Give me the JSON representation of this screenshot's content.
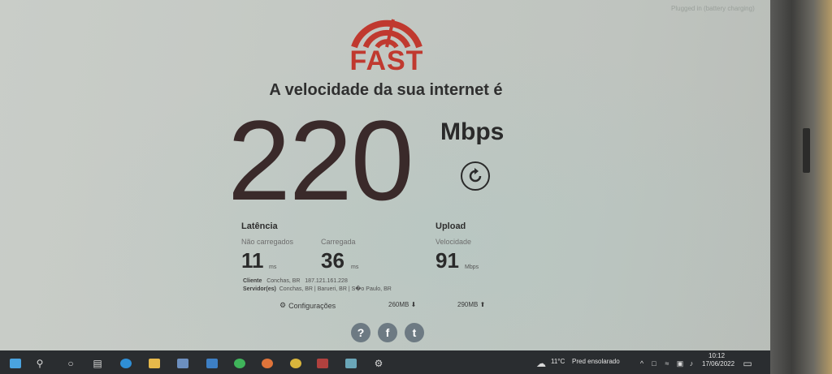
{
  "top_right_tag": "Plugged in (battery charging)",
  "logo": {
    "text": "FAST"
  },
  "headline": "A velocidade da sua internet é",
  "speed": {
    "value": "220",
    "unit": "Mbps"
  },
  "latency": {
    "title": "Latência",
    "unloaded_label": "Não carregados",
    "unloaded_value": "11",
    "unloaded_unit": "ms",
    "loaded_label": "Carregada",
    "loaded_value": "36",
    "loaded_unit": "ms"
  },
  "upload": {
    "title": "Upload",
    "label": "Velocidade",
    "value": "91",
    "unit": "Mbps"
  },
  "client": {
    "label": "Cliente",
    "location": "Conchas, BR",
    "ip": "187.121.161.228"
  },
  "servers": {
    "label": "Servidor(es)",
    "list": "Conchas, BR  |  Barueri, BR  |  S�o Paulo, BR"
  },
  "settings_label": "Configurações",
  "download_total": "260MB",
  "upload_total": "290MB",
  "social": {
    "help": "?",
    "facebook": "f",
    "twitter": "t"
  },
  "taskbar": {
    "temperature": "11°C",
    "weather": "Pred ensolarado",
    "time": "10:12",
    "date": "17/06/2022"
  },
  "colors": {
    "brand": "#c0392f",
    "text_dark": "#2a2a2a",
    "taskbar": "#2a2d30",
    "social": "#6d7a83"
  }
}
